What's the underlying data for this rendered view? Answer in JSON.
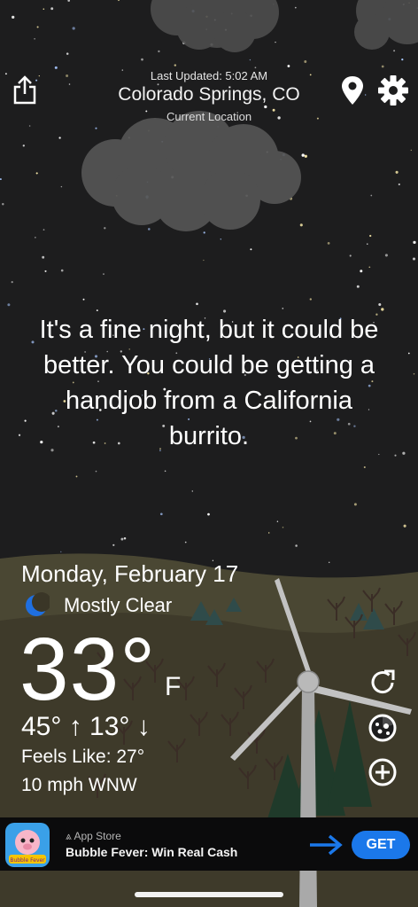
{
  "header": {
    "last_updated": "Last Updated: 5:02 AM",
    "city": "Colorado Springs, CO",
    "location_mode": "Current Location",
    "share_icon": "share-icon",
    "location_icon": "map-pin-icon",
    "settings_icon": "gear-icon"
  },
  "quote": "It's a fine night, but it could be better. You could be getting a handjob from a California burrito.",
  "weather": {
    "date": "Monday, February 17",
    "condition_icon": "moon-icon",
    "condition": "Mostly Clear",
    "temperature": "33°",
    "unit": "F",
    "hi_lo": "45° ↑ 13° ↓",
    "feels_like": "Feels Like: 27°",
    "wind": "10 mph WNW"
  },
  "actions": {
    "refresh_icon": "refresh-icon",
    "radar_icon": "radar-icon",
    "add_icon": "add-circle-icon"
  },
  "ad": {
    "store": "App Store",
    "title": "Bubble Fever: Win Real Cash",
    "cta": "GET",
    "icon_text": "Bubble Fever",
    "cta_color": "#1b78ea"
  },
  "colors": {
    "sky": "#1d1d1e",
    "hill_front": "#3e3a2a",
    "hill_back": "#4a4733"
  }
}
